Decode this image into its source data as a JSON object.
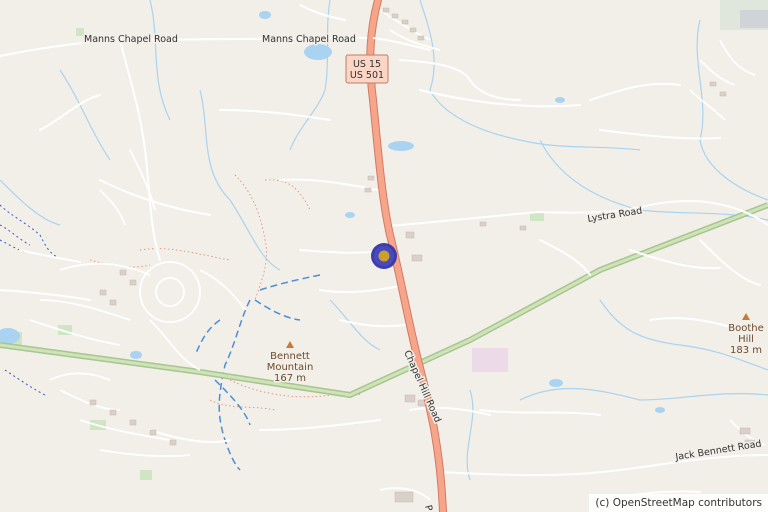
{
  "roads": {
    "manns_chapel_west": "Manns Chapel Road",
    "manns_chapel_east": "Manns Chapel Road",
    "lystra": "Lystra Road",
    "chapel_hill": "Chapel Hill Road",
    "jack_bennett": "Jack Bennett Road",
    "chapel_hill_cut": "P"
  },
  "shield": {
    "line1": "US 15",
    "line2": "US 501"
  },
  "peaks": {
    "bennett": {
      "name_line1": "Bennett",
      "name_line2": "Mountain",
      "elevation": "167 m"
    },
    "boothe": {
      "name_line1": "Boothe",
      "name_line2": "Hill",
      "elevation": "183 m"
    }
  },
  "marker": {
    "icon": "location-marker-icon"
  },
  "attribution": "(c) OpenStreetMap contributors",
  "colors": {
    "land": "#f2efe9",
    "highway": "#f7a58a",
    "highway_casing": "#d07b62",
    "minor_road": "#ffffff",
    "water": "#a9d3f0",
    "trail": "#a7c58e",
    "marker_ring": "#3535a8",
    "marker_center": "#c9a227"
  }
}
